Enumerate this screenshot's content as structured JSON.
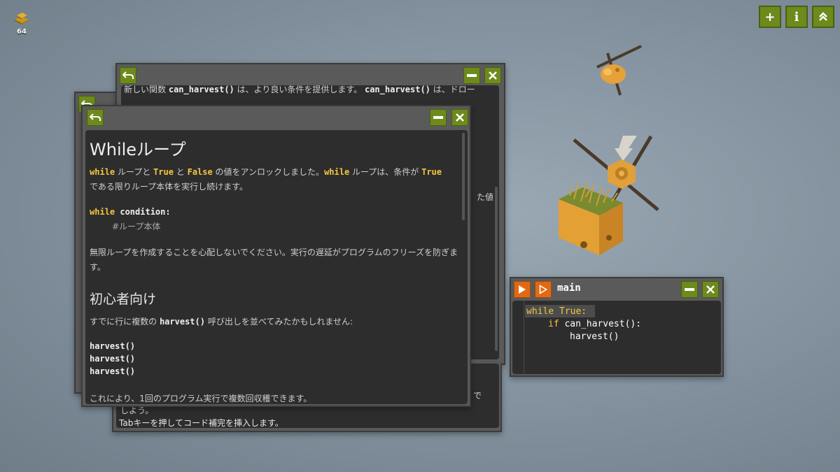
{
  "hud": {
    "gold_count": "64",
    "gold_icon": "gold-bars-icon"
  },
  "top_buttons": [
    {
      "name": "add-window-button",
      "glyph": "+"
    },
    {
      "name": "info-button",
      "glyph": "i"
    },
    {
      "name": "collapse-button",
      "glyph": "︽"
    }
  ],
  "back_window": {
    "line1_a": "新しい関数",
    "line1_fn": "can_harvest()",
    "line1_b": "は、より良い条件を提供します。",
    "line1_fn2": "can_harvest()",
    "line1_c": "は、ドロー",
    "side_text": "た値",
    "bottom1": "しよう。",
    "bottom2": "Tabキーを押してコード補完を挿入します。",
    "bottom_edge": "で"
  },
  "front_window": {
    "title": "Whileループ",
    "p1_kw1": "while",
    "p1_a": " ループと ",
    "p1_kw2": "True",
    "p1_b": " と ",
    "p1_kw3": "False",
    "p1_c": " の値をアンロックしました。",
    "p1_kw4": "while",
    "p1_d": " ループは、条件が ",
    "p1_kw5": "True",
    "p1_e": "である限りループ本体を実行し続けます。",
    "code_kw": "while",
    "code_cond": "condition:",
    "code_comment": "#ループ本体",
    "p2": "無限ループを作成することを心配しないでください。実行の遅延がプログラムのフリーズを防ぎます。",
    "heading2": "初心者向け",
    "p3_a": "すでに行に複数の",
    "p3_fn": "harvest()",
    "p3_b": "呼び出しを並べてみたかもしれません:",
    "code_lines": [
      "harvest()",
      "harvest()",
      "harvest()"
    ],
    "p4": "これにより、1回のプログラム実行で複数回収穫できます。"
  },
  "code_window": {
    "title": "main",
    "line1_kw": "while",
    "line1_val": " True:",
    "line2_kw": "if",
    "line2_fn": " can_harvest():",
    "line3_fn": "harvest()"
  },
  "colors": {
    "accent_green": "#6d8a1c",
    "accent_orange": "#e06a14",
    "keyword_yellow": "#f3c63f"
  }
}
